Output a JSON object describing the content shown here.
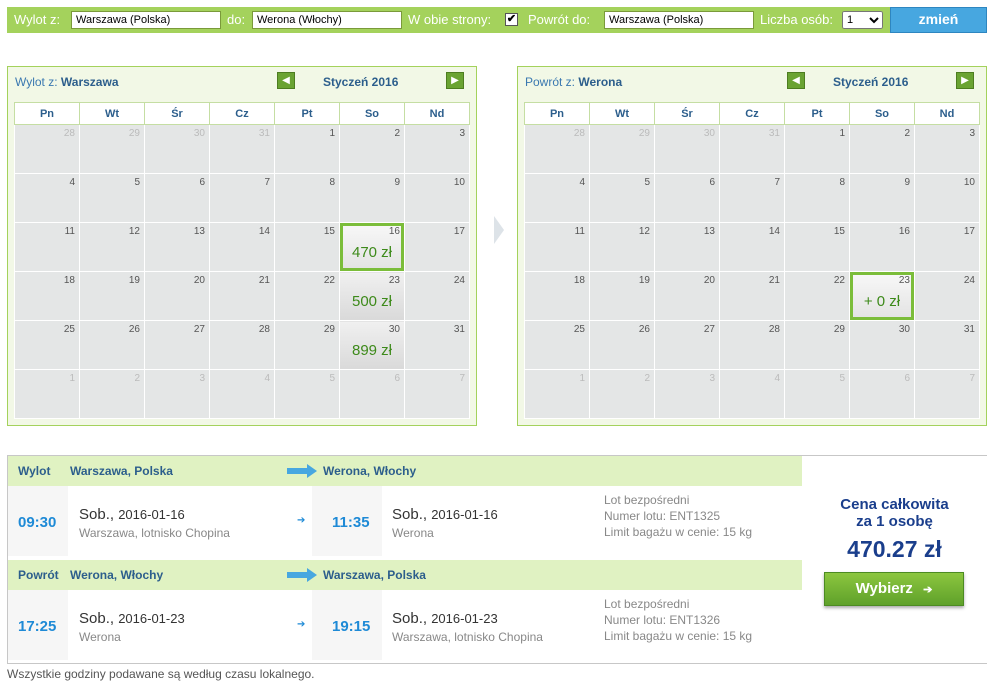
{
  "search": {
    "from_label": "Wylot z:",
    "from_value": "Warszawa (Polska)",
    "to_label": "do:",
    "to_value": "Werona (Włochy)",
    "both_ways_label": "W obie strony:",
    "both_ways_checked": "✔",
    "return_label": "Powrót do:",
    "return_value": "Warszawa (Polska)",
    "persons_label": "Liczba osób:",
    "persons_value": "1",
    "change_button": "zmień"
  },
  "outbound_calendar": {
    "route_prefix": "Wylot z:",
    "route_city": "Warszawa",
    "month": "Styczeń 2016",
    "weekdays": [
      "Pn",
      "Wt",
      "Śr",
      "Cz",
      "Pt",
      "So",
      "Nd"
    ],
    "weeks": [
      [
        {
          "d": "28",
          "o": 1
        },
        {
          "d": "29",
          "o": 1
        },
        {
          "d": "30",
          "o": 1
        },
        {
          "d": "31",
          "o": 1
        },
        {
          "d": "1"
        },
        {
          "d": "2"
        },
        {
          "d": "3"
        }
      ],
      [
        {
          "d": "4"
        },
        {
          "d": "5"
        },
        {
          "d": "6"
        },
        {
          "d": "7"
        },
        {
          "d": "8"
        },
        {
          "d": "9"
        },
        {
          "d": "10"
        }
      ],
      [
        {
          "d": "11"
        },
        {
          "d": "12"
        },
        {
          "d": "13"
        },
        {
          "d": "14"
        },
        {
          "d": "15"
        },
        {
          "d": "16",
          "p": "470 zł",
          "sel": 1
        },
        {
          "d": "17"
        }
      ],
      [
        {
          "d": "18"
        },
        {
          "d": "19"
        },
        {
          "d": "20"
        },
        {
          "d": "21"
        },
        {
          "d": "22"
        },
        {
          "d": "23",
          "p": "500 zł"
        },
        {
          "d": "24"
        }
      ],
      [
        {
          "d": "25"
        },
        {
          "d": "26"
        },
        {
          "d": "27"
        },
        {
          "d": "28"
        },
        {
          "d": "29"
        },
        {
          "d": "30",
          "p": "899 zł"
        },
        {
          "d": "31"
        }
      ],
      [
        {
          "d": "1",
          "o": 1
        },
        {
          "d": "2",
          "o": 1
        },
        {
          "d": "3",
          "o": 1
        },
        {
          "d": "4",
          "o": 1
        },
        {
          "d": "5",
          "o": 1
        },
        {
          "d": "6",
          "o": 1
        },
        {
          "d": "7",
          "o": 1
        }
      ]
    ]
  },
  "return_calendar": {
    "route_prefix": "Powrót z:",
    "route_city": "Werona",
    "month": "Styczeń 2016",
    "weekdays": [
      "Pn",
      "Wt",
      "Śr",
      "Cz",
      "Pt",
      "So",
      "Nd"
    ],
    "weeks": [
      [
        {
          "d": "28",
          "o": 1
        },
        {
          "d": "29",
          "o": 1
        },
        {
          "d": "30",
          "o": 1
        },
        {
          "d": "31",
          "o": 1
        },
        {
          "d": "1"
        },
        {
          "d": "2"
        },
        {
          "d": "3"
        }
      ],
      [
        {
          "d": "4"
        },
        {
          "d": "5"
        },
        {
          "d": "6"
        },
        {
          "d": "7"
        },
        {
          "d": "8"
        },
        {
          "d": "9"
        },
        {
          "d": "10"
        }
      ],
      [
        {
          "d": "11"
        },
        {
          "d": "12"
        },
        {
          "d": "13"
        },
        {
          "d": "14"
        },
        {
          "d": "15"
        },
        {
          "d": "16"
        },
        {
          "d": "17"
        }
      ],
      [
        {
          "d": "18"
        },
        {
          "d": "19"
        },
        {
          "d": "20"
        },
        {
          "d": "21"
        },
        {
          "d": "22"
        },
        {
          "d": "23",
          "p": "+ 0 zł",
          "sel": 1
        },
        {
          "d": "24"
        }
      ],
      [
        {
          "d": "25"
        },
        {
          "d": "26"
        },
        {
          "d": "27"
        },
        {
          "d": "28"
        },
        {
          "d": "29"
        },
        {
          "d": "30"
        },
        {
          "d": "31"
        }
      ],
      [
        {
          "d": "1",
          "o": 1
        },
        {
          "d": "2",
          "o": 1
        },
        {
          "d": "3",
          "o": 1
        },
        {
          "d": "4",
          "o": 1
        },
        {
          "d": "5",
          "o": 1
        },
        {
          "d": "6",
          "o": 1
        },
        {
          "d": "7",
          "o": 1
        }
      ]
    ]
  },
  "outbound": {
    "label": "Wylot",
    "from": "Warszawa, Polska",
    "to": "Werona, Włochy",
    "dep_time": "09:30",
    "dep_day": "Sob.,",
    "dep_date": "2016-01-16",
    "dep_airport": "Warszawa, lotnisko Chopina",
    "arr_time": "11:35",
    "arr_day": "Sob.,",
    "arr_date": "2016-01-16",
    "arr_airport": "Werona",
    "info_direct": "Lot bezpośredni",
    "info_flight": "Numer lotu: ENT1325",
    "info_baggage": "Limit bagażu w cenie: 15 kg"
  },
  "return": {
    "label": "Powrót",
    "from": "Werona, Włochy",
    "to": "Warszawa, Polska",
    "dep_time": "17:25",
    "dep_day": "Sob.,",
    "dep_date": "2016-01-23",
    "dep_airport": "Werona",
    "arr_time": "19:15",
    "arr_day": "Sob.,",
    "arr_date": "2016-01-23",
    "arr_airport": "Warszawa, lotnisko Chopina",
    "info_direct": "Lot bezpośredni",
    "info_flight": "Numer lotu: ENT1326",
    "info_baggage": "Limit bagażu w cenie: 15 kg"
  },
  "price": {
    "label_line1": "Cena całkowita",
    "label_line2": "za 1 osobę",
    "value": "470.27 zł",
    "choose_button": "Wybierz"
  },
  "footnote": "Wszystkie godziny podawane są według czasu lokalnego.",
  "colors": {
    "accent_green": "#a4d25c",
    "button_blue": "#47a7e0",
    "time_blue": "#1e8ad6",
    "price_green": "#3d8a1a"
  },
  "icons": {
    "prev": "arrow-left-icon",
    "next": "arrow-right-icon",
    "leg_arrow": "arrow-right-icon",
    "choose_arrow": "arrow-right-icon"
  }
}
